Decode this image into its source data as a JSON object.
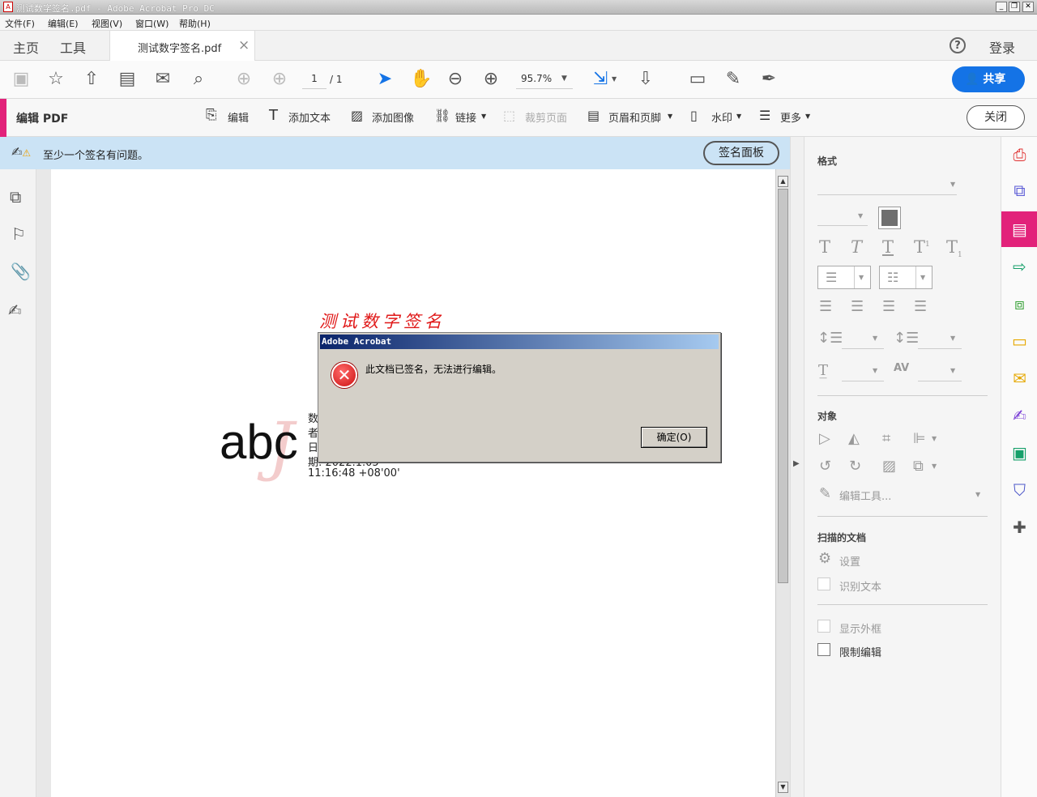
{
  "window": {
    "title": "测试数字签名.pdf - Adobe Acrobat Pro DC",
    "minimize": "_",
    "restore": "❐",
    "close": "✕"
  },
  "menu": [
    "文件(F)",
    "编辑(E)",
    "视图(V)",
    "窗口(W)",
    "帮助(H)"
  ],
  "nav": {
    "home": "主页",
    "tools": "工具",
    "doc_tab": "测试数字签名.pdf",
    "doc_tab_close": "×",
    "help": "?",
    "login": "登录"
  },
  "toolbar": {
    "page_current": "1",
    "page_total": "/ 1",
    "zoom": "95.7%",
    "share": "共享"
  },
  "editbar": {
    "title": "编辑 PDF",
    "items": [
      "编辑",
      "添加文本",
      "添加图像",
      "链接",
      "裁剪页面",
      "页眉和页脚",
      "水印",
      "更多"
    ],
    "close": "关闭"
  },
  "notification": {
    "text": "至少一个签名有问题。",
    "button": "签名面板"
  },
  "document": {
    "heading": "测试数字签名",
    "abc": "abc",
    "sig_lines": [
      "数",
      "者",
      "日",
      "期: 2022.1.05"
    ],
    "sig_time": "11:16:48 +08'00'"
  },
  "format_panel": {
    "format_title": "格式",
    "object_title": "对象",
    "edit_tool": "编辑工具...",
    "scanned_title": "扫描的文档",
    "settings": "设置",
    "recognize": "识别文本",
    "show_bbox": "显示外框",
    "restrict": "限制编辑"
  },
  "dialog": {
    "title": "Adobe Acrobat",
    "message": "此文档已签名，无法进行编辑。",
    "ok": "确定(O)"
  },
  "colors": {
    "accent_pink": "#e2227a",
    "share_blue": "#1473e6",
    "notify_bg": "#cbe3f5",
    "error_red": "#cc1111"
  }
}
